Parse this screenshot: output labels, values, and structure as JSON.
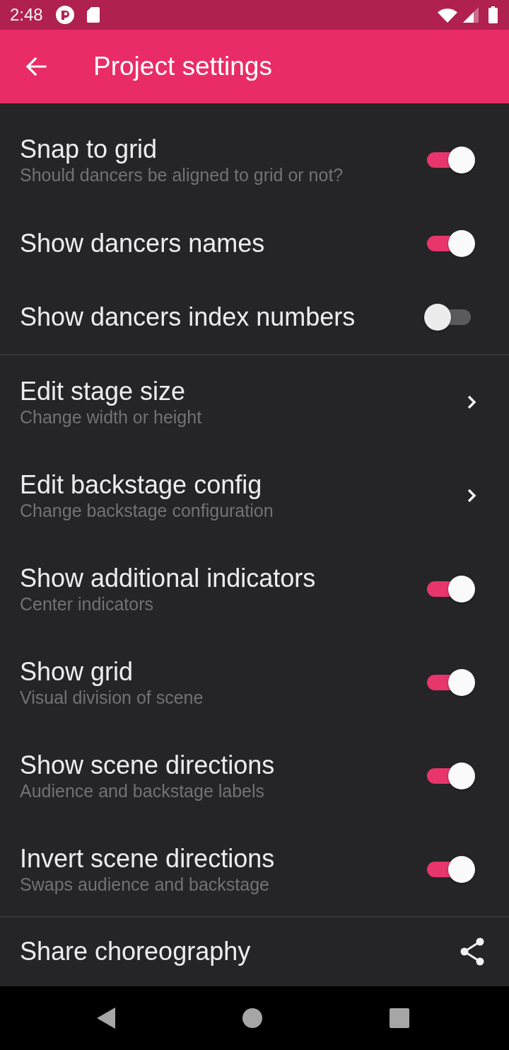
{
  "status_bar": {
    "time": "2:48"
  },
  "app_bar": {
    "title": "Project settings"
  },
  "sections": [
    {
      "items": [
        {
          "kind": "toggle",
          "title": "Snap to grid",
          "subtitle": "Should dancers be aligned to grid or not?",
          "on": true
        },
        {
          "kind": "toggle",
          "title": "Show dancers names",
          "on": true
        },
        {
          "kind": "toggle",
          "title": "Show dancers index numbers",
          "on": false
        }
      ]
    },
    {
      "items": [
        {
          "kind": "navigate",
          "title": "Edit stage size",
          "subtitle": "Change width or height"
        },
        {
          "kind": "navigate",
          "title": "Edit backstage config",
          "subtitle": "Change backstage configuration"
        },
        {
          "kind": "toggle",
          "title": "Show additional indicators",
          "subtitle": "Center indicators",
          "on": true
        },
        {
          "kind": "toggle",
          "title": "Show grid",
          "subtitle": "Visual division of scene",
          "on": true
        },
        {
          "kind": "toggle",
          "title": "Show scene directions",
          "subtitle": "Audience and backstage labels",
          "on": true
        },
        {
          "kind": "toggle",
          "title": "Invert scene directions",
          "subtitle": "Swaps audience and backstage",
          "on": true
        }
      ]
    },
    {
      "items": [
        {
          "kind": "share",
          "title": "Share choreography"
        }
      ]
    }
  ]
}
